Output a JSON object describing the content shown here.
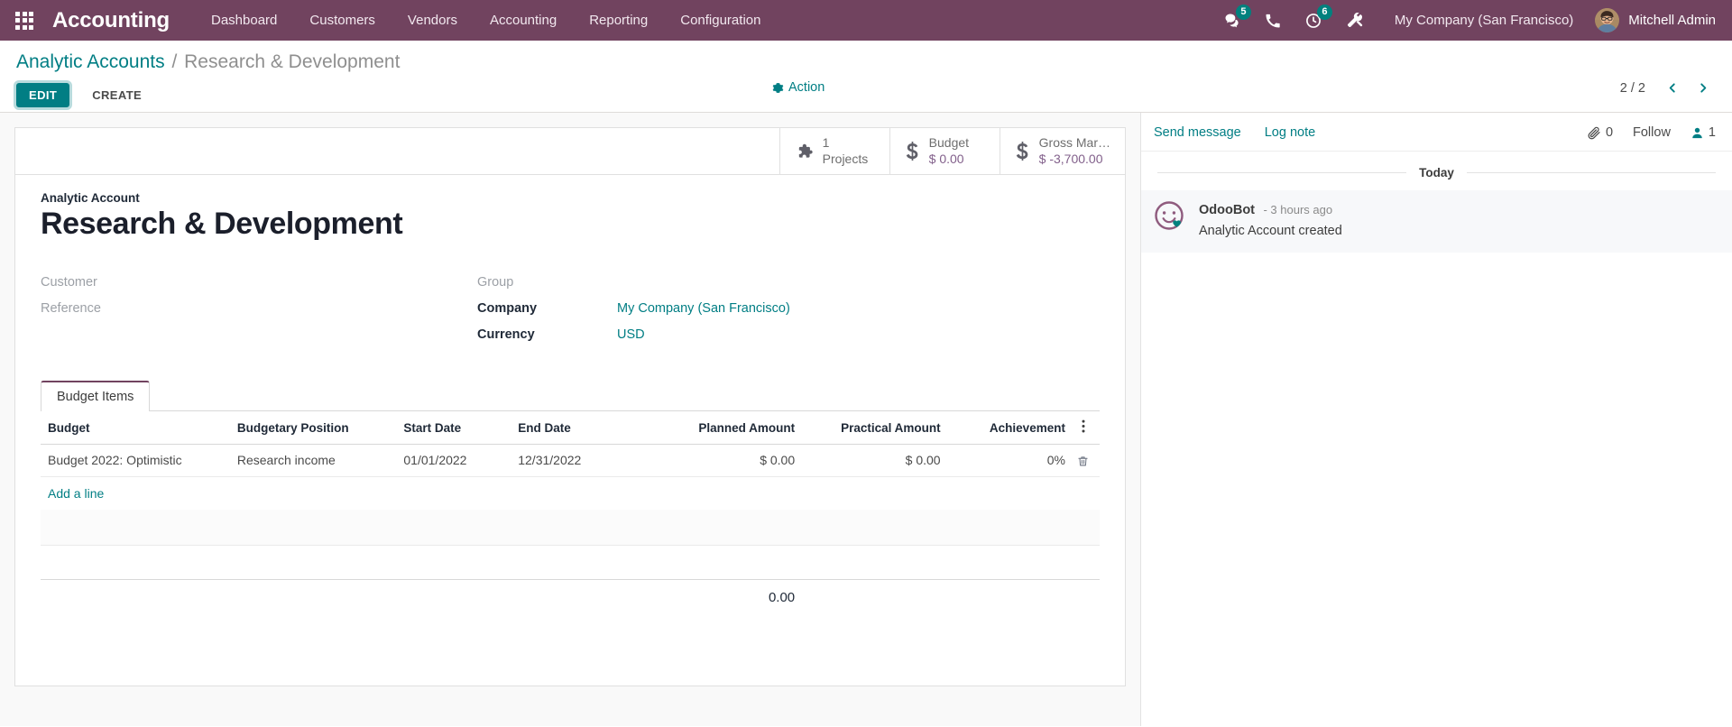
{
  "navbar": {
    "apps_icon": "apps-grid-icon",
    "brand": "Accounting",
    "menu_items": [
      {
        "label": "Dashboard"
      },
      {
        "label": "Customers"
      },
      {
        "label": "Vendors"
      },
      {
        "label": "Accounting"
      },
      {
        "label": "Reporting"
      },
      {
        "label": "Configuration"
      }
    ],
    "icons": {
      "messages": {
        "name": "messages-icon",
        "badge": "5"
      },
      "phone": {
        "name": "phone-icon",
        "badge": ""
      },
      "activities": {
        "name": "activity-clock-icon",
        "badge": "6"
      },
      "debug": {
        "name": "tools-wrench-icon",
        "badge": ""
      }
    },
    "company": "My Company (San Francisco)",
    "user": "Mitchell Admin"
  },
  "control_panel": {
    "breadcrumb_parent": "Analytic Accounts",
    "breadcrumb_sep": "/",
    "breadcrumb_current": "Research & Development",
    "edit_label": "EDIT",
    "create_label": "CREATE",
    "action_label": "Action",
    "action_icon": "gear-icon",
    "pager_value": "2 / 2",
    "pager_prev_icon": "chevron-left-icon",
    "pager_next_icon": "chevron-right-icon"
  },
  "stat_buttons": [
    {
      "icon": "puzzle-piece-icon",
      "line1": "1",
      "line2": "Projects",
      "line2_style": "plain"
    },
    {
      "icon": "dollar-sign-icon",
      "line1": "Budget",
      "line2": "$ 0.00",
      "line2_style": "accent"
    },
    {
      "icon": "dollar-sign-icon",
      "line1": "Gross Mar…",
      "line2": "$ -3,700.00",
      "line2_style": "accent"
    }
  ],
  "form": {
    "title_label": "Analytic Account",
    "title": "Research & Development",
    "left_fields": [
      {
        "label": "Customer",
        "value": "",
        "filled": false
      },
      {
        "label": "Reference",
        "value": "",
        "filled": false
      }
    ],
    "right_fields": [
      {
        "label": "Group",
        "value": "",
        "filled": false
      },
      {
        "label": "Company",
        "value": "My Company (San Francisco)",
        "filled": true
      },
      {
        "label": "Currency",
        "value": "USD",
        "filled": true
      }
    ]
  },
  "notebook": {
    "tabs": [
      {
        "label": "Budget Items",
        "active": true
      }
    ]
  },
  "budget_table": {
    "columns": [
      "Budget",
      "Budgetary Position",
      "Start Date",
      "End Date",
      "Planned Amount",
      "Practical Amount",
      "Achievement"
    ],
    "rows": [
      {
        "budget": "Budget 2022: Optimistic",
        "budgetary_position": "Research income",
        "start_date": "01/01/2022",
        "end_date": "12/31/2022",
        "planned_amount": "$ 0.00",
        "practical_amount": "$ 0.00",
        "achievement": "0%",
        "delete_icon": "trash-icon"
      }
    ],
    "add_line_label": "Add a line",
    "optional_columns_icon": "vertical-dots-icon",
    "total": "0.00"
  },
  "chatter": {
    "send_message": "Send message",
    "log_note": "Log note",
    "attachment_icon": "paperclip-icon",
    "attachment_count": "0",
    "follow_label": "Follow",
    "followers_icon": "user-icon",
    "followers_count": "1",
    "date_separator": "Today",
    "messages": [
      {
        "author": "OdooBot",
        "avatar": "odoobot-avatar",
        "time": "- 3 hours ago",
        "text": "Analytic Account created"
      }
    ]
  },
  "colors": {
    "brand_purple": "#71435f",
    "accent_teal": "#017e84",
    "badge_teal": "#00817e",
    "stat_value": "#82608b"
  }
}
